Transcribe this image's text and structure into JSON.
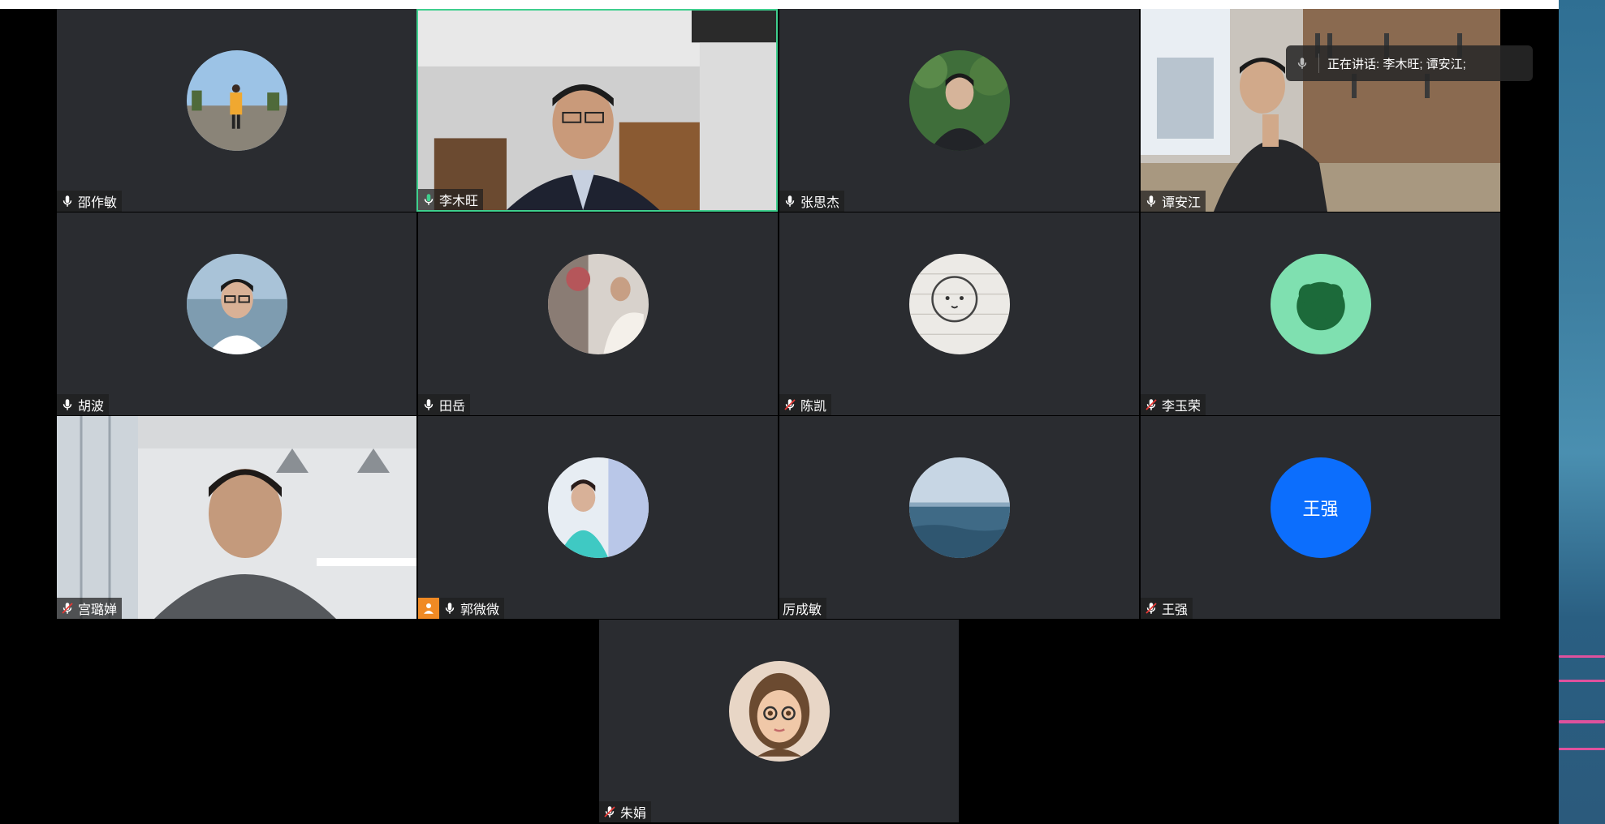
{
  "speaking": {
    "text": "正在讲话: 李木旺; 谭安江;"
  },
  "participants": [
    {
      "name": "邵作敏",
      "mic": "on",
      "kind": "photo",
      "active": false
    },
    {
      "name": "李木旺",
      "mic": "speaking",
      "kind": "video",
      "active": true
    },
    {
      "name": "张思杰",
      "mic": "on",
      "kind": "photo",
      "active": false
    },
    {
      "name": "谭安江",
      "mic": "on",
      "kind": "video",
      "active": false
    },
    {
      "name": "胡波",
      "mic": "on",
      "kind": "photo",
      "active": false
    },
    {
      "name": "田岳",
      "mic": "on",
      "kind": "photo",
      "active": false
    },
    {
      "name": "陈凯",
      "mic": "muted",
      "kind": "photo",
      "active": false
    },
    {
      "name": "李玉荣",
      "mic": "muted",
      "kind": "photo",
      "active": false
    },
    {
      "name": "宫璐婵",
      "mic": "muted",
      "kind": "video",
      "active": false
    },
    {
      "name": "郭微微",
      "mic": "on",
      "kind": "photo",
      "active": false
    },
    {
      "name": "厉成敏",
      "mic": "none",
      "kind": "photo",
      "active": false
    },
    {
      "name": "王强",
      "mic": "muted",
      "kind": "initials",
      "initials": "王强",
      "active": false
    },
    {
      "name": "朱娟",
      "mic": "muted",
      "kind": "photo",
      "active": false
    }
  ],
  "colors": {
    "tile_bg": "#2a2c30",
    "active_border": "#3fcf8e",
    "initials_avatar": "#0c6efd",
    "camera_badge": "#f08a24"
  }
}
